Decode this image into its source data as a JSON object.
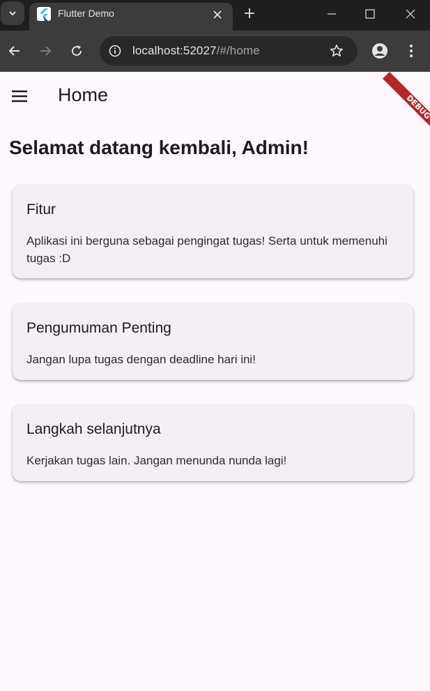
{
  "browser": {
    "tab_title": "Flutter Demo",
    "url_host": "localhost:52027",
    "url_path": "/#/home"
  },
  "app": {
    "appbar_title": "Home",
    "debug_label": "DEBUG",
    "welcome": "Selamat datang kembali, Admin!",
    "cards": [
      {
        "title": "Fitur",
        "body": "Aplikasi ini berguna sebagai pengingat tugas! Serta untuk memenuhi tugas :D"
      },
      {
        "title": "Pengumuman Penting",
        "body": "Jangan lupa tugas dengan deadline hari ini!"
      },
      {
        "title": "Langkah selanjutnya",
        "body": "Kerjakan tugas lain. Jangan menunda nunda lagi!"
      }
    ]
  },
  "colors": {
    "background": "#fdf7fe",
    "card": "#f4eff6",
    "debug_banner": "#b3262b",
    "chrome_dark": "#1f1f1f",
    "chrome_toolbar": "#3c3c3c"
  },
  "icons": [
    "tab-list-icon",
    "flutter-icon",
    "close-icon",
    "plus-icon",
    "minimize-icon",
    "maximize-icon",
    "window-close-icon",
    "back-icon",
    "forward-icon",
    "reload-icon",
    "site-info-icon",
    "star-icon",
    "profile-icon",
    "more-icon",
    "hamburger-icon"
  ]
}
